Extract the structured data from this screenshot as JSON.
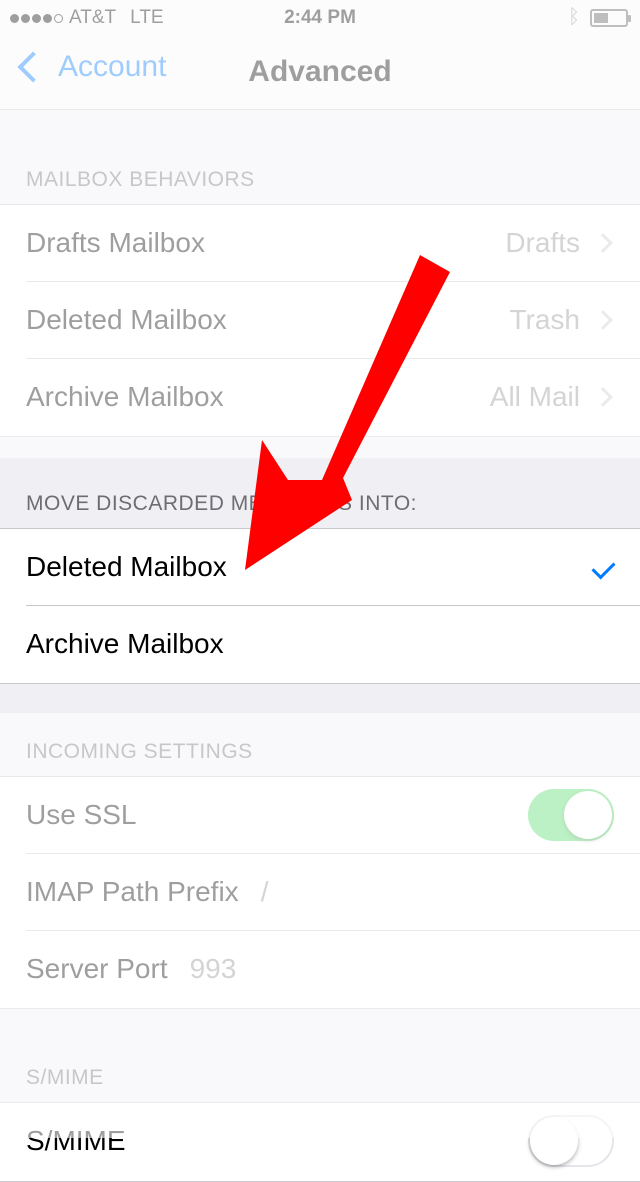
{
  "status_bar": {
    "carrier": "AT&T",
    "network": "LTE",
    "time": "2:44 PM",
    "battery_level": 0.45
  },
  "nav": {
    "back_label": "Account",
    "title": "Advanced"
  },
  "mailbox_behaviors": {
    "header": "MAILBOX BEHAVIORS",
    "rows": [
      {
        "label": "Drafts Mailbox",
        "value": "Drafts"
      },
      {
        "label": "Deleted Mailbox",
        "value": "Trash"
      },
      {
        "label": "Archive Mailbox",
        "value": "All Mail"
      }
    ]
  },
  "move_discarded": {
    "header": "MOVE DISCARDED MESSAGES INTO:",
    "rows": [
      {
        "label": "Deleted Mailbox",
        "selected": true
      },
      {
        "label": "Archive Mailbox",
        "selected": false
      }
    ]
  },
  "incoming_settings": {
    "header": "INCOMING SETTINGS",
    "use_ssl_label": "Use SSL",
    "use_ssl_on": true,
    "imap_path_label": "IMAP Path Prefix",
    "imap_path_value": "/",
    "server_port_label": "Server Port",
    "server_port_value": "993"
  },
  "smime": {
    "header": "S/MIME",
    "row_label": "S/MIME",
    "on": false
  },
  "colors": {
    "accent": "#007aff",
    "toggle_on": "#4cd964",
    "annotation": "#ff0000"
  }
}
